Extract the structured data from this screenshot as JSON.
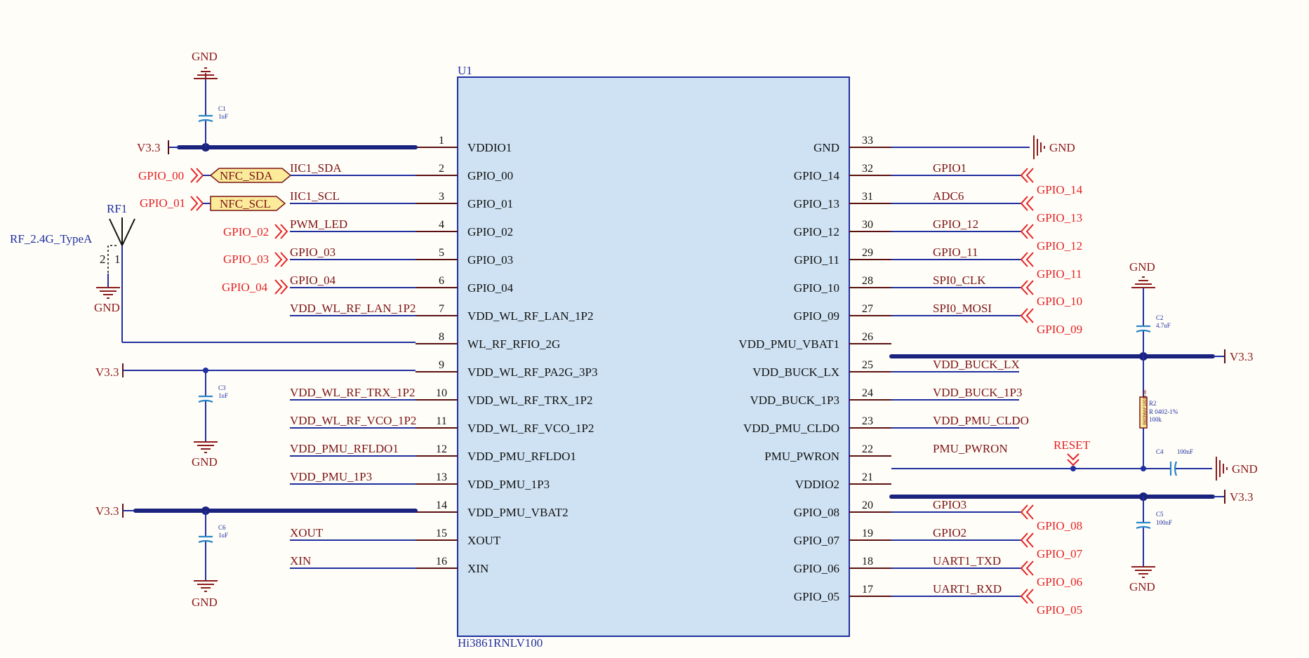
{
  "chip": {
    "designator": "U1",
    "part": "Hi3861RNLV100",
    "fill": "#cfe2f3",
    "left_pins": [
      {
        "num": "1",
        "name": "VDDIO1",
        "net": ""
      },
      {
        "num": "2",
        "name": "GPIO_00",
        "net": "IIC1_SDA"
      },
      {
        "num": "3",
        "name": "GPIO_01",
        "net": "IIC1_SCL"
      },
      {
        "num": "4",
        "name": "GPIO_02",
        "net": "PWM_LED"
      },
      {
        "num": "5",
        "name": "GPIO_03",
        "net": "GPIO_03"
      },
      {
        "num": "6",
        "name": "GPIO_04",
        "net": "GPIO_04"
      },
      {
        "num": "7",
        "name": "VDD_WL_RF_LAN_1P2",
        "net": "VDD_WL_RF_LAN_1P2"
      },
      {
        "num": "8",
        "name": "WL_RF_RFIO_2G",
        "net": ""
      },
      {
        "num": "9",
        "name": "VDD_WL_RF_PA2G_3P3",
        "net": ""
      },
      {
        "num": "10",
        "name": "VDD_WL_RF_TRX_1P2",
        "net": "VDD_WL_RF_TRX_1P2"
      },
      {
        "num": "11",
        "name": "VDD_WL_RF_VCO_1P2",
        "net": "VDD_WL_RF_VCO_1P2"
      },
      {
        "num": "12",
        "name": "VDD_PMU_RFLDO1",
        "net": "VDD_PMU_RFLDO1"
      },
      {
        "num": "13",
        "name": "VDD_PMU_1P3",
        "net": "VDD_PMU_1P3"
      },
      {
        "num": "14",
        "name": "VDD_PMU_VBAT2",
        "net": ""
      },
      {
        "num": "15",
        "name": "XOUT",
        "net": "XOUT"
      },
      {
        "num": "16",
        "name": "XIN",
        "net": "XIN"
      }
    ],
    "right_pins": [
      {
        "num": "33",
        "name": "GND",
        "net": ""
      },
      {
        "num": "32",
        "name": "GPIO_14",
        "net": "GPIO1"
      },
      {
        "num": "31",
        "name": "GPIO_13",
        "net": "ADC6"
      },
      {
        "num": "30",
        "name": "GPIO_12",
        "net": "GPIO_12"
      },
      {
        "num": "29",
        "name": "GPIO_11",
        "net": "GPIO_11"
      },
      {
        "num": "28",
        "name": "GPIO_10",
        "net": "SPI0_CLK"
      },
      {
        "num": "27",
        "name": "GPIO_09",
        "net": "SPI0_MOSI"
      },
      {
        "num": "26",
        "name": "VDD_PMU_VBAT1",
        "net": ""
      },
      {
        "num": "25",
        "name": "VDD_BUCK_LX",
        "net": "VDD_BUCK_LX"
      },
      {
        "num": "24",
        "name": "VDD_BUCK_1P3",
        "net": "VDD_BUCK_1P3"
      },
      {
        "num": "23",
        "name": "VDD_PMU_CLDO",
        "net": "VDD_PMU_CLDO"
      },
      {
        "num": "22",
        "name": "PMU_PWRON",
        "net": "PMU_PWRON"
      },
      {
        "num": "21",
        "name": "VDDIO2",
        "net": ""
      },
      {
        "num": "20",
        "name": "GPIO_08",
        "net": "GPIO3"
      },
      {
        "num": "19",
        "name": "GPIO_07",
        "net": "GPIO2"
      },
      {
        "num": "18",
        "name": "GPIO_06",
        "net": "UART1_TXD"
      },
      {
        "num": "17",
        "name": "GPIO_05",
        "net": "UART1_RXD"
      }
    ]
  },
  "left_ports": [
    "GPIO_00",
    "GPIO_01",
    "GPIO_02",
    "GPIO_03",
    "GPIO_04"
  ],
  "right_ports": [
    "GPIO_14",
    "GPIO_13",
    "GPIO_12",
    "GPIO_11",
    "GPIO_10",
    "GPIO_09",
    "GPIO_08",
    "GPIO_07",
    "GPIO_06",
    "GPIO_05"
  ],
  "nfc": {
    "sda": "NFC_SDA",
    "scl": "NFC_SCL",
    "fill": "#fbeb9a"
  },
  "power": {
    "v33": "V3.3",
    "gnd": "GND",
    "reset": "RESET"
  },
  "antenna": {
    "designator": "RF1",
    "part": "RF_2.4G_TypeA",
    "pin1": "1",
    "pin2": "2"
  },
  "caps": {
    "c1": {
      "ref": "C1",
      "val": "1uF"
    },
    "c2": {
      "ref": "C2",
      "val": "4.7uF"
    },
    "c3": {
      "ref": "C3",
      "val": "1uF"
    },
    "c4": {
      "ref": "C4",
      "val": "100nF"
    },
    "c5": {
      "ref": "C5",
      "val": "100nF"
    },
    "c6": {
      "ref": "C6",
      "val": "1uF"
    }
  },
  "resistor": {
    "ref": "R2",
    "pkg": "R 0402-1%",
    "val": "100k",
    "code": "0603WAF1003T5E"
  },
  "colors": {
    "wire": "#1f2f9f",
    "bus": "#1a237e",
    "port": "#e32222",
    "net_label": "#7a1414",
    "capacitor": "#2a86c8"
  }
}
